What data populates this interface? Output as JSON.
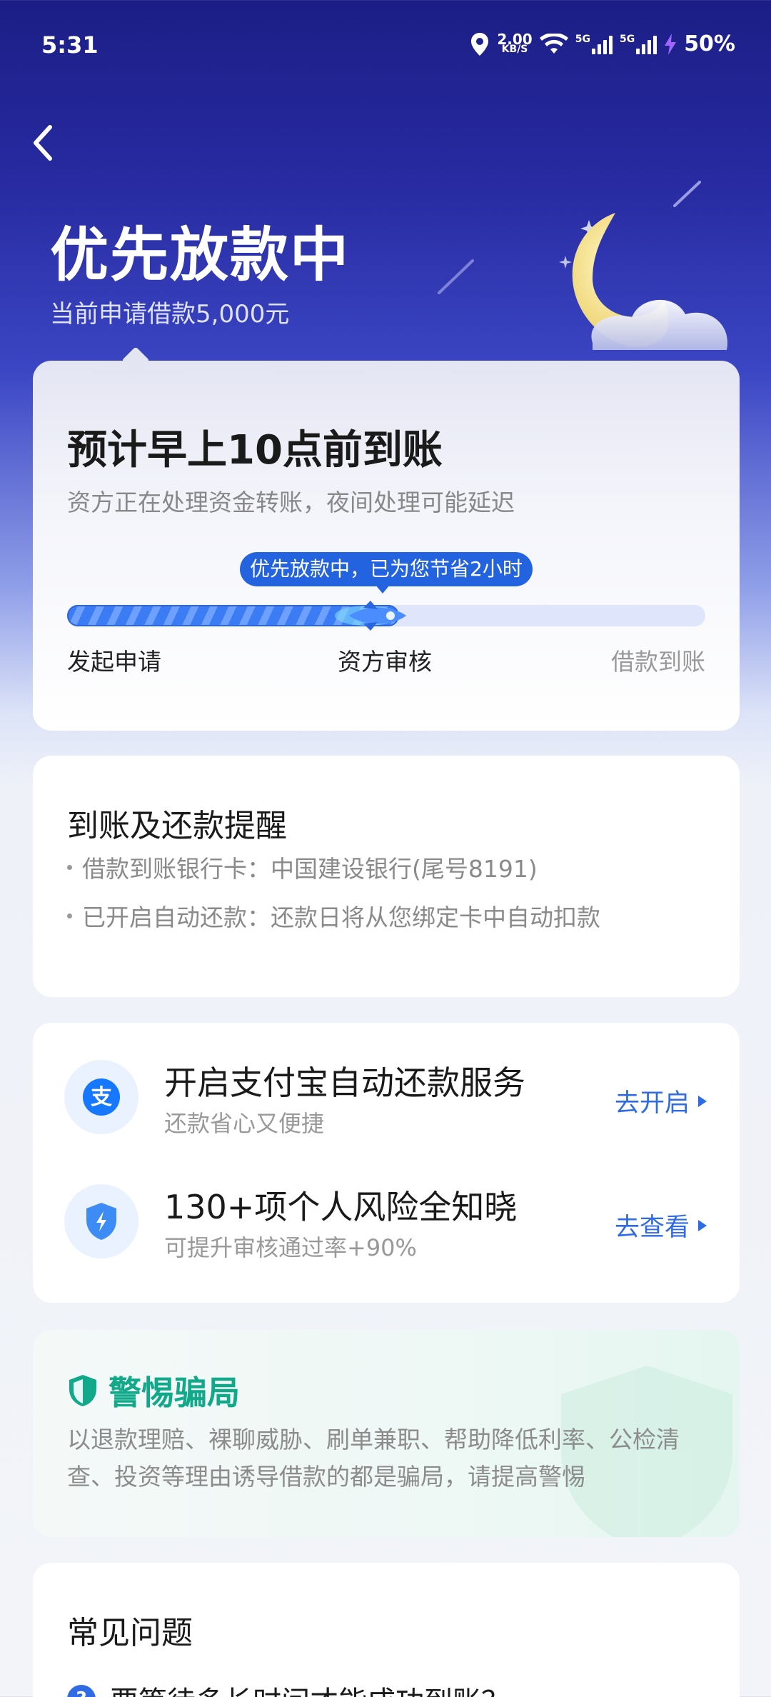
{
  "status_bar": {
    "time": "5:31",
    "net_speed_value": "2.00",
    "net_speed_unit": "KB/S",
    "sim1_label": "5G",
    "sim2_label": "5G",
    "battery": "50%",
    "icons": [
      "location-icon",
      "wifi-icon",
      "signal-icon",
      "signal-icon",
      "charging-icon"
    ]
  },
  "header": {
    "title": "优先放款中",
    "subtitle": "当前申请借款5,000元"
  },
  "eta": {
    "title": "预计早上10点前到账",
    "desc": "资方正在处理资金转账，夜间处理可能延迟",
    "badge": "优先放款中，已为您节省2小时",
    "progress": 0.52,
    "steps": [
      "发起申请",
      "资方审核",
      "借款到账"
    ]
  },
  "reminder": {
    "title": "到账及还款提醒",
    "items": [
      "借款到账银行卡：中国建设银行(尾号8191)",
      "已开启自动还款：还款日将从您绑定卡中自动扣款"
    ]
  },
  "services": [
    {
      "icon": "alipay-icon",
      "title": "开启支付宝自动还款服务",
      "sub": "还款省心又便捷",
      "action": "去开启"
    },
    {
      "icon": "shield-bolt-icon",
      "title": "130+项个人风险全知晓",
      "sub": "可提升审核通过率+90%",
      "action": "去查看"
    }
  ],
  "fraud": {
    "title": "警惕骗局",
    "text": "以退款理赔、裸聊威胁、刷单兼职、帮助降低利率、公检清查、投资等理由诱导借款的都是骗局，请提高警惕"
  },
  "faq": {
    "title": "常见问题",
    "first_question": "要等待多长时间才能成功到账？"
  },
  "colors": {
    "accent": "#2e6be5",
    "hero_bg": "#1c1e86",
    "fraud_green": "#12a98b"
  }
}
